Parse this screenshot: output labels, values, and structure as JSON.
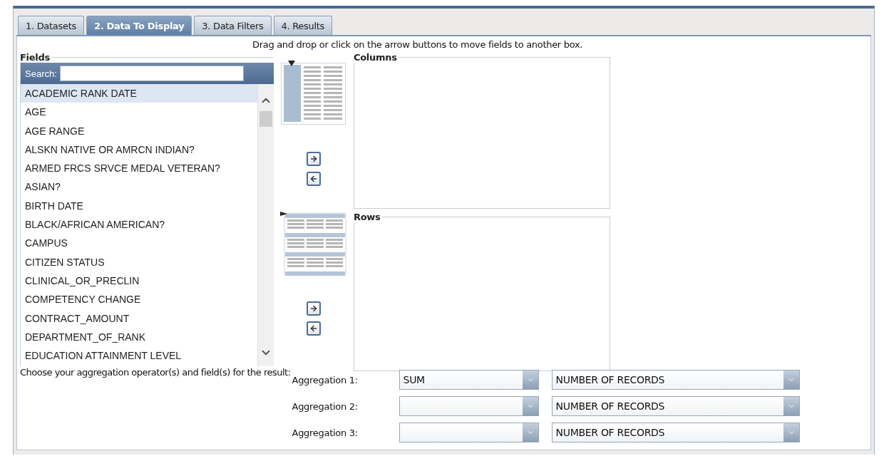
{
  "tabs": [
    {
      "label": "1. Datasets",
      "selected": false
    },
    {
      "label": "2. Data To Display",
      "selected": true
    },
    {
      "label": "3. Data Filters",
      "selected": false
    },
    {
      "label": "4. Results",
      "selected": false
    }
  ],
  "instruction": "Drag and drop or click on the arrow buttons to move fields to another box.",
  "fields": {
    "legend": "Fields",
    "search_label": "Search:",
    "items": [
      {
        "label": "ACADEMIC RANK DATE",
        "selected": true
      },
      {
        "label": "AGE",
        "selected": false
      },
      {
        "label": "AGE RANGE",
        "selected": false
      },
      {
        "label": "ALSKN NATIVE OR AMRCN INDIAN?",
        "selected": false
      },
      {
        "label": "ARMED FRCS SRVCE MEDAL VETERAN?",
        "selected": false
      },
      {
        "label": "ASIAN?",
        "selected": false
      },
      {
        "label": "BIRTH DATE",
        "selected": false
      },
      {
        "label": "BLACK/AFRICAN AMERICAN?",
        "selected": false
      },
      {
        "label": "CAMPUS",
        "selected": false
      },
      {
        "label": "CITIZEN STATUS",
        "selected": false
      },
      {
        "label": "CLINICAL_OR_PRECLIN",
        "selected": false
      },
      {
        "label": "COMPETENCY CHANGE",
        "selected": false
      },
      {
        "label": "CONTRACT_AMOUNT",
        "selected": false
      },
      {
        "label": "DEPARTMENT_OF_RANK",
        "selected": false
      },
      {
        "label": "EDUCATION ATTAINMENT LEVEL",
        "selected": false
      }
    ]
  },
  "targets": [
    {
      "kind": "columns",
      "legend": "Columns"
    },
    {
      "kind": "rows",
      "legend": "Rows"
    }
  ],
  "aggregation_prompt": "Choose your aggregation operator(s) and field(s) for the result:",
  "aggregations": [
    {
      "label": "Aggregation 1:",
      "operator": "SUM",
      "field": "NUMBER OF RECORDS"
    },
    {
      "label": "Aggregation 2:",
      "field": "NUMBER OF RECORDS"
    },
    {
      "label": "Aggregation 3:",
      "field": "NUMBER OF RECORDS"
    }
  ]
}
